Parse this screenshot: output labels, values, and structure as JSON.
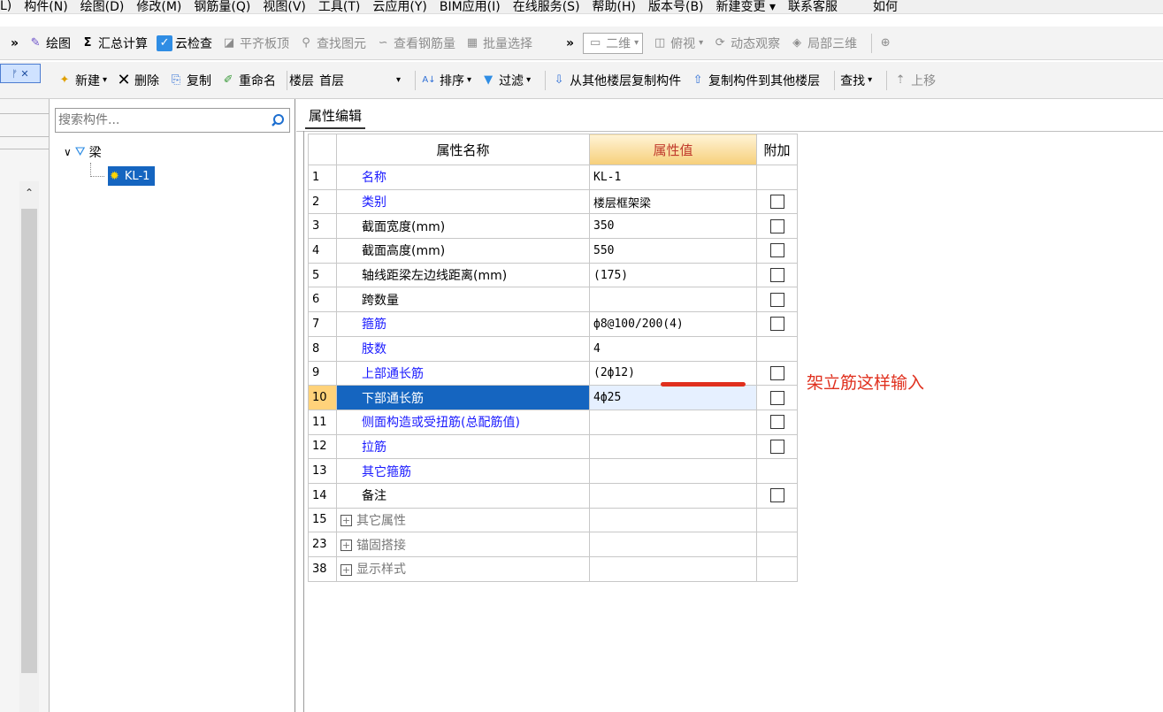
{
  "menubar": {
    "items": [
      "L)",
      "构件(N)",
      "绘图(D)",
      "修改(M)",
      "钢筋量(Q)",
      "视图(V)",
      "工具(T)",
      "云应用(Y)",
      "BIM应用(I)",
      "在线服务(S)",
      "帮助(H)",
      "版本号(B)",
      "新建变更 ▾",
      "联系客服",
      "如何"
    ]
  },
  "toolbar1": {
    "more": "»",
    "draw": "绘图",
    "sum_icon": "Σ",
    "calc": "汇总计算",
    "cloud_check": "云检查",
    "flat_top": "平齐板顶",
    "find_element": "查找图元",
    "view_rebar": "查看钢筋量",
    "batch_select": "批量选择",
    "more2": "»",
    "view_2d": "二维",
    "top_view": "俯视",
    "dynamic": "动态观察",
    "local3d": "局部三维"
  },
  "toolbar2": {
    "pin": "ᚠ ✕",
    "new": "新建",
    "delete": "删除",
    "copy": "复制",
    "rename": "重命名",
    "floor_label": "楼层",
    "floor_value": "首层",
    "sort": "排序",
    "filter": "过滤",
    "copy_from": "从其他楼层复制构件",
    "copy_to": "复制构件到其他楼层",
    "find": "查找",
    "move_up": "上移"
  },
  "tree": {
    "search_placeholder": "搜索构件...",
    "root": "梁",
    "child": "KL-1"
  },
  "tab": {
    "label": "属性编辑"
  },
  "table": {
    "headers": {
      "name": "属性名称",
      "value": "属性值",
      "extra": "附加"
    },
    "rows": [
      {
        "idx": "1",
        "name": "名称",
        "value": "KL-1",
        "blue": true,
        "check": false
      },
      {
        "idx": "2",
        "name": "类别",
        "value": "楼层框架梁",
        "blue": true,
        "check": true
      },
      {
        "idx": "3",
        "name": "截面宽度(mm)",
        "value": "350",
        "blue": false,
        "check": true
      },
      {
        "idx": "4",
        "name": "截面高度(mm)",
        "value": "550",
        "blue": false,
        "check": true
      },
      {
        "idx": "5",
        "name": "轴线距梁左边线距离(mm)",
        "value": "(175)",
        "blue": false,
        "check": true
      },
      {
        "idx": "6",
        "name": "跨数量",
        "value": "",
        "blue": false,
        "check": true
      },
      {
        "idx": "7",
        "name": "箍筋",
        "value": "ф8@100/200(4)",
        "blue": true,
        "check": true
      },
      {
        "idx": "8",
        "name": "肢数",
        "value": "4",
        "blue": true,
        "check": false
      },
      {
        "idx": "9",
        "name": "上部通长筋",
        "value": "(2ф12)",
        "blue": true,
        "check": true
      },
      {
        "idx": "10",
        "name": "下部通长筋",
        "value": "4ф25",
        "blue": true,
        "check": true,
        "selected": true
      },
      {
        "idx": "11",
        "name": "侧面构造或受扭筋(总配筋值)",
        "value": "",
        "blue": true,
        "check": true
      },
      {
        "idx": "12",
        "name": "拉筋",
        "value": "",
        "blue": true,
        "check": true
      },
      {
        "idx": "13",
        "name": "其它箍筋",
        "value": "",
        "blue": true,
        "check": false
      },
      {
        "idx": "14",
        "name": "备注",
        "value": "",
        "blue": false,
        "check": true
      }
    ],
    "groups": [
      {
        "idx": "15",
        "name": "其它属性"
      },
      {
        "idx": "23",
        "name": "锚固搭接"
      },
      {
        "idx": "38",
        "name": "显示样式"
      }
    ]
  },
  "annotation": "架立筋这样输入",
  "colors": {
    "accent_blue": "#1565c0",
    "link_blue": "#1a1aff",
    "annotation_red": "#e0301e",
    "header_gold": "#f6cf7a"
  }
}
